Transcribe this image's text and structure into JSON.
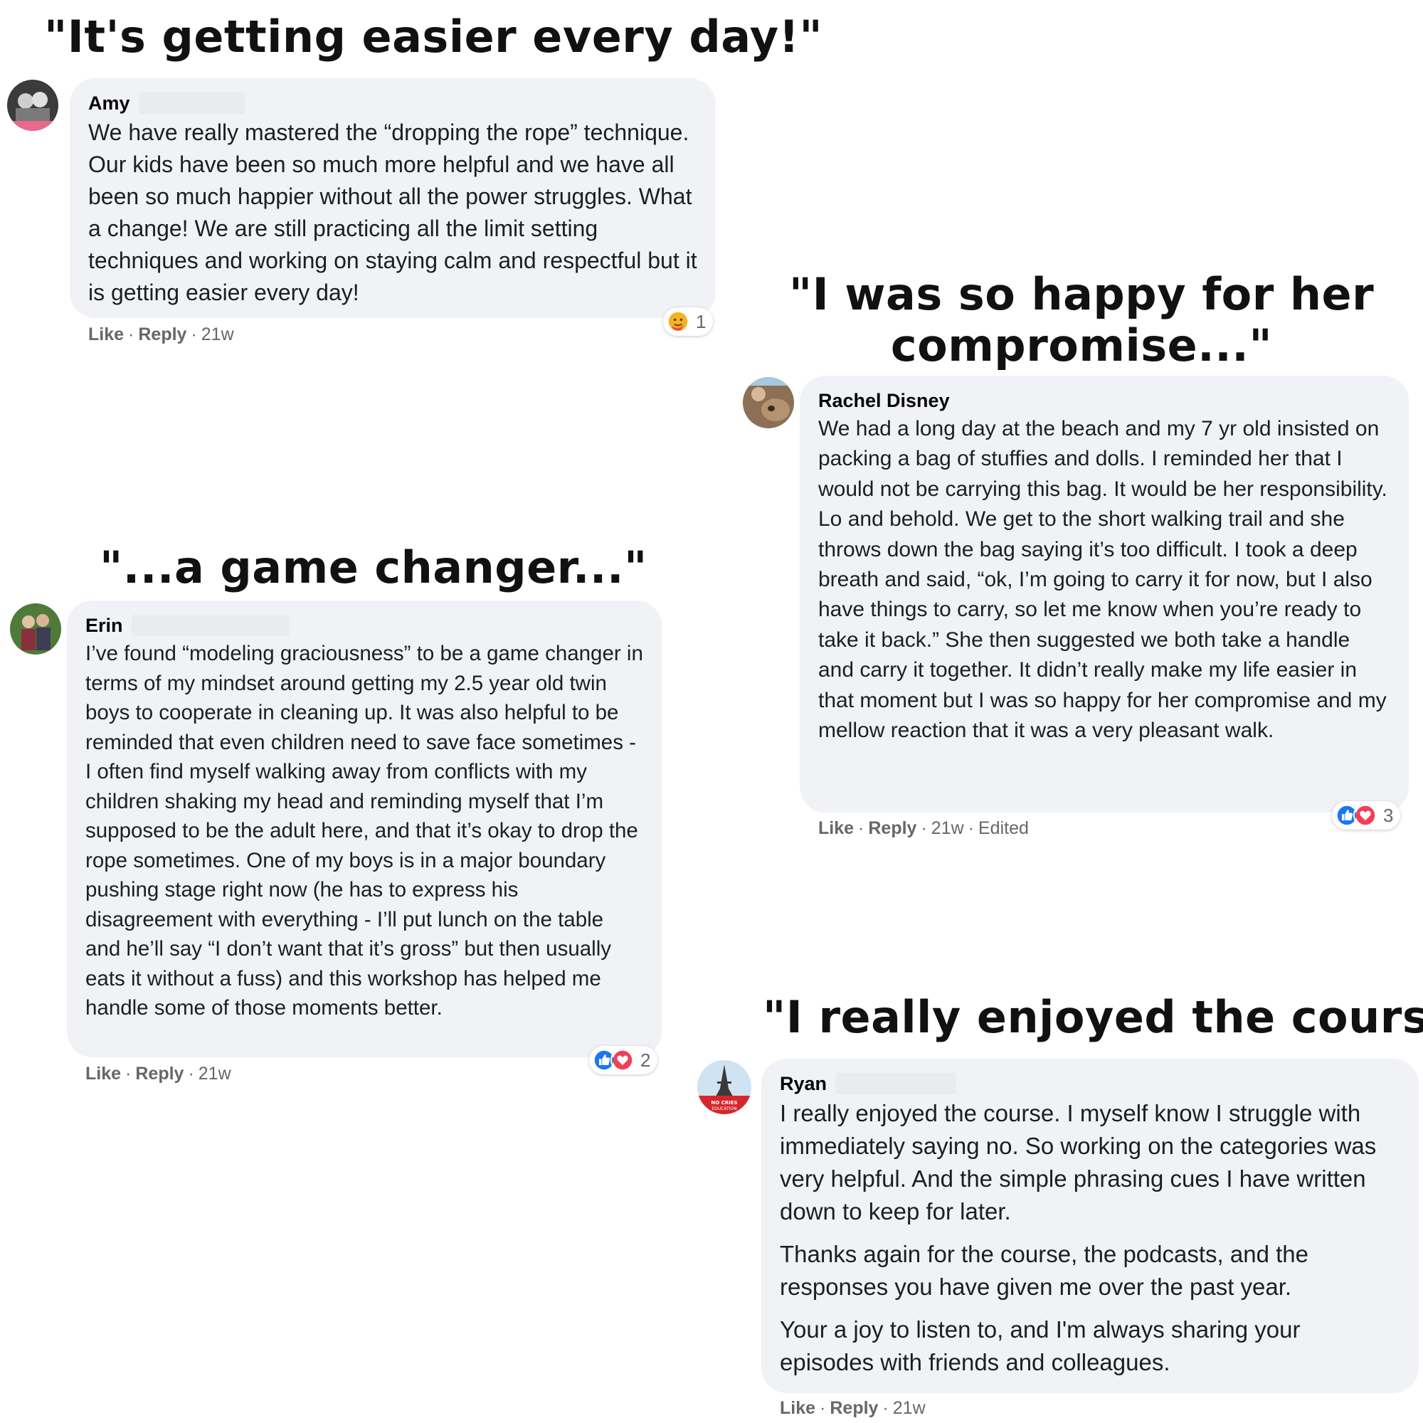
{
  "headlines": {
    "amy": "\"It's getting easier every day!\"",
    "rachel": "\"I was so happy for her compromise...\"",
    "erin": "\"...a game changer...\"",
    "ryan": "\"I really enjoyed the course\""
  },
  "comments": {
    "amy": {
      "author": "Amy",
      "paragraphs": [
        "We have really mastered the “dropping the rope” technique. Our kids have been so much more helpful and we have all been so much happier without all the power struggles. What a change! We are still practicing all the limit setting techniques and working on staying calm and respectful but it is getting easier every day!"
      ],
      "reaction_count": "1",
      "reactions": [
        "care-icon"
      ],
      "actions": {
        "like": "Like",
        "reply": "Reply",
        "time": "21w",
        "edited": ""
      }
    },
    "rachel": {
      "author": "Rachel Disney",
      "paragraphs": [
        "We had a long day at the beach and my 7 yr old insisted on packing a bag of stuffies and dolls. I reminded her that I would not be carrying this bag. It would be her responsibility. Lo and behold. We get to the short walking trail and she throws down the bag saying it’s too difficult. I took a deep breath and said, “ok, I’m going to carry it for now, but I also have things to carry, so let me know when you’re ready to take it back.” She then suggested we both take a handle and carry it together. It didn’t really make my life easier in that moment but I was so happy for her compromise and my mellow reaction that it was a very pleasant walk."
      ],
      "reaction_count": "3",
      "reactions": [
        "like-icon",
        "love-icon"
      ],
      "actions": {
        "like": "Like",
        "reply": "Reply",
        "time": "21w",
        "edited": "Edited"
      }
    },
    "erin": {
      "author": "Erin",
      "paragraphs": [
        "I’ve found “modeling graciousness” to be a game changer in terms of my mindset around getting my 2.5 year old twin boys to cooperate in cleaning up. It was also helpful to be reminded that even children need to save face sometimes - I often find myself walking away from conflicts with my children shaking my head and reminding myself that I’m supposed to be the adult here, and that it’s okay to drop the rope sometimes. One of my boys is in a major boundary pushing stage right now (he has to express his disagreement with everything - I’ll put lunch on the table and he’ll say “I don’t want that it’s gross” but then usually eats it without a fuss) and this workshop has helped me handle some of those moments better."
      ],
      "reaction_count": "2",
      "reactions": [
        "like-icon",
        "love-icon"
      ],
      "actions": {
        "like": "Like",
        "reply": "Reply",
        "time": "21w",
        "edited": ""
      }
    },
    "ryan": {
      "author": "Ryan",
      "paragraphs": [
        "I really enjoyed the course. I myself know I struggle with immediately saying no. So working on the categories was very helpful. And the simple phrasing cues I have written down to keep for later.",
        "Thanks again for the course, the podcasts, and the responses you have given me over the past year.",
        "Your a joy to listen to, and I'm always sharing your episodes with friends and colleagues."
      ],
      "avatar_text": "NO CRIES EDUCATION",
      "actions": {
        "like": "Like",
        "reply": "Reply",
        "time": "21w",
        "edited": ""
      }
    }
  },
  "colors": {
    "bubble": "#f0f2f5",
    "meta_text": "#65676b",
    "like_blue": "#1877f2",
    "love_red": "#f33e58"
  }
}
